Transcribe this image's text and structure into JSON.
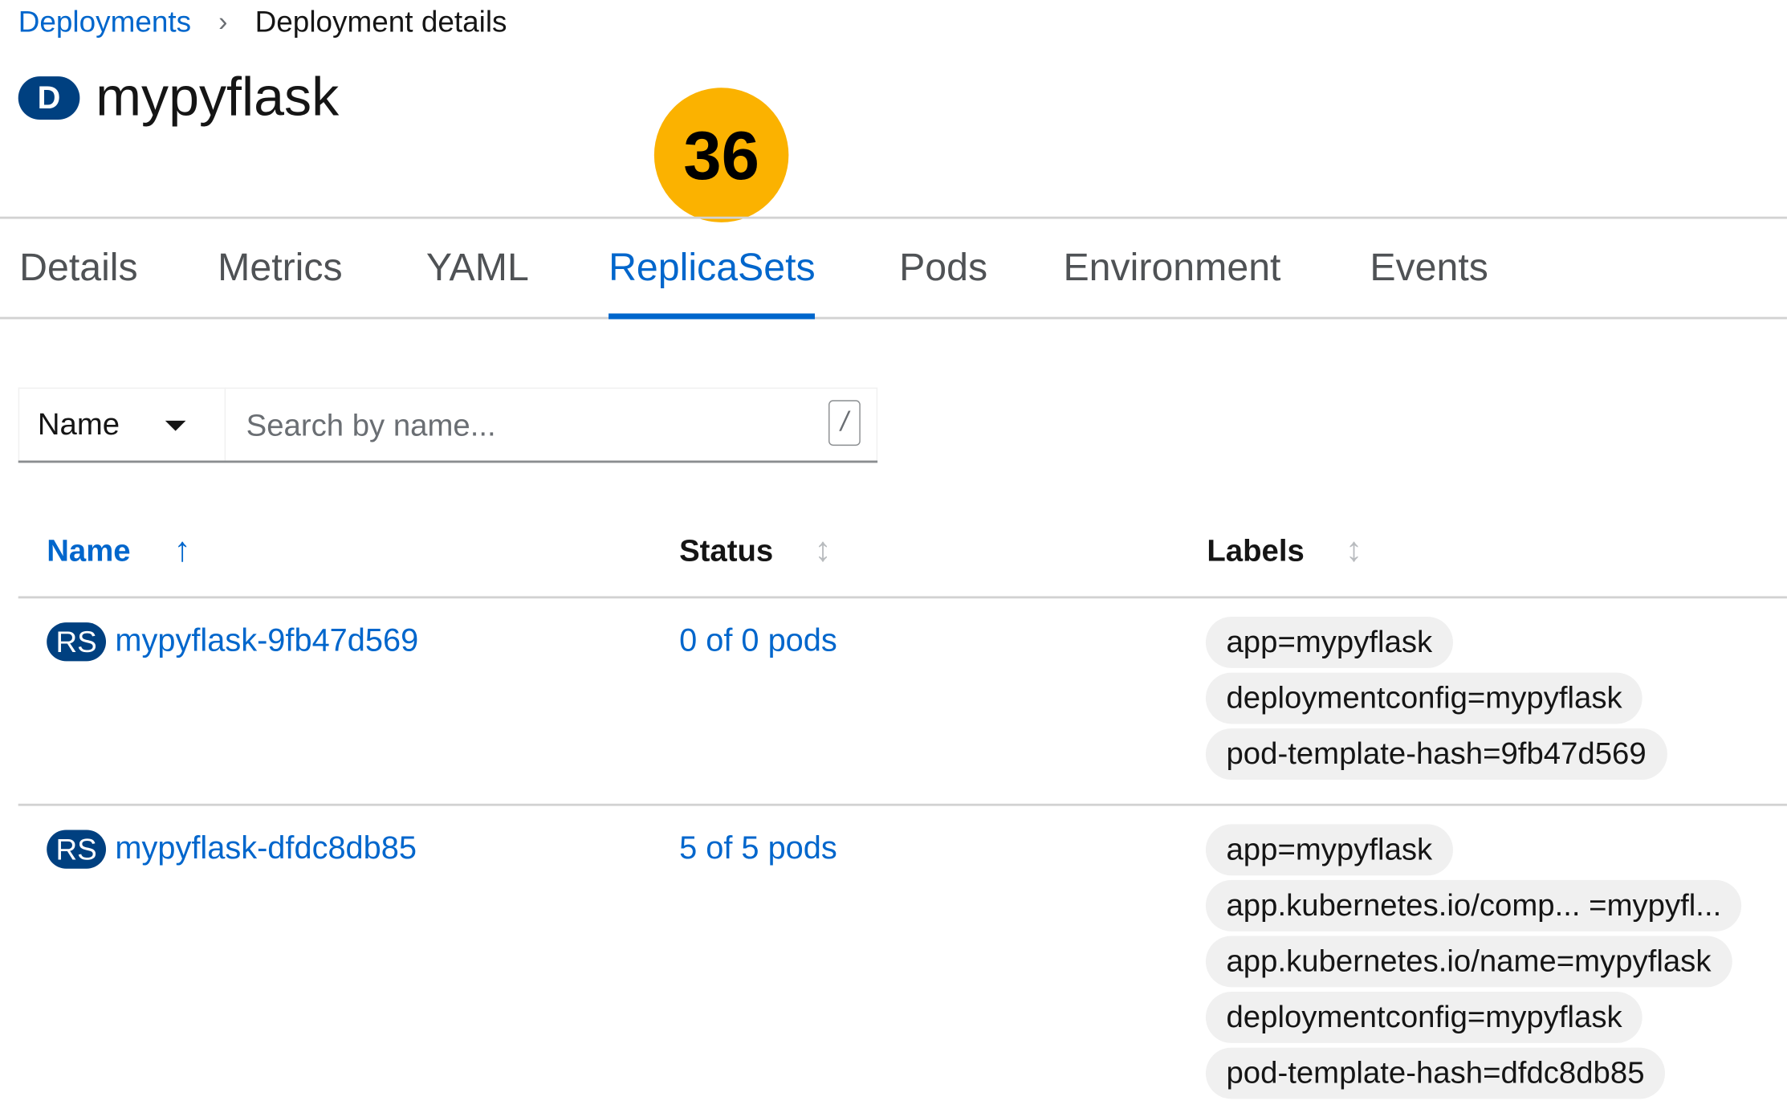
{
  "breadcrumb": {
    "parent": "Deployments",
    "current": "Deployment details"
  },
  "header": {
    "kind_badge": "D",
    "title": "mypyflask"
  },
  "step_badge": "36",
  "tabs": [
    {
      "label": "Details"
    },
    {
      "label": "Metrics"
    },
    {
      "label": "YAML"
    },
    {
      "label": "ReplicaSets",
      "active": true
    },
    {
      "label": "Pods"
    },
    {
      "label": "Environment"
    },
    {
      "label": "Events"
    }
  ],
  "filter": {
    "type_label": "Name",
    "placeholder": "Search by name...",
    "shortcut": "/"
  },
  "table": {
    "columns": {
      "name": "Name",
      "status": "Status",
      "labels": "Labels"
    },
    "rows": [
      {
        "badge": "RS",
        "name": "mypyflask-9fb47d569",
        "status": "0 of 0 pods",
        "labels": [
          "app=mypyflask",
          "deploymentconfig=mypyflask",
          "pod-template-hash=9fb47d569"
        ]
      },
      {
        "badge": "RS",
        "name": "mypyflask-dfdc8db85",
        "status": "5 of 5 pods",
        "labels": [
          "app=mypyflask",
          "app.kubernetes.io/comp...  =mypyfl...",
          "app.kubernetes.io/name=mypyflask",
          "deploymentconfig=mypyflask",
          "pod-template-hash=dfdc8db85"
        ]
      }
    ]
  },
  "colors": {
    "link": "#0066cc",
    "badge_bg": "#004080",
    "step_badge_bg": "#fbb200"
  }
}
